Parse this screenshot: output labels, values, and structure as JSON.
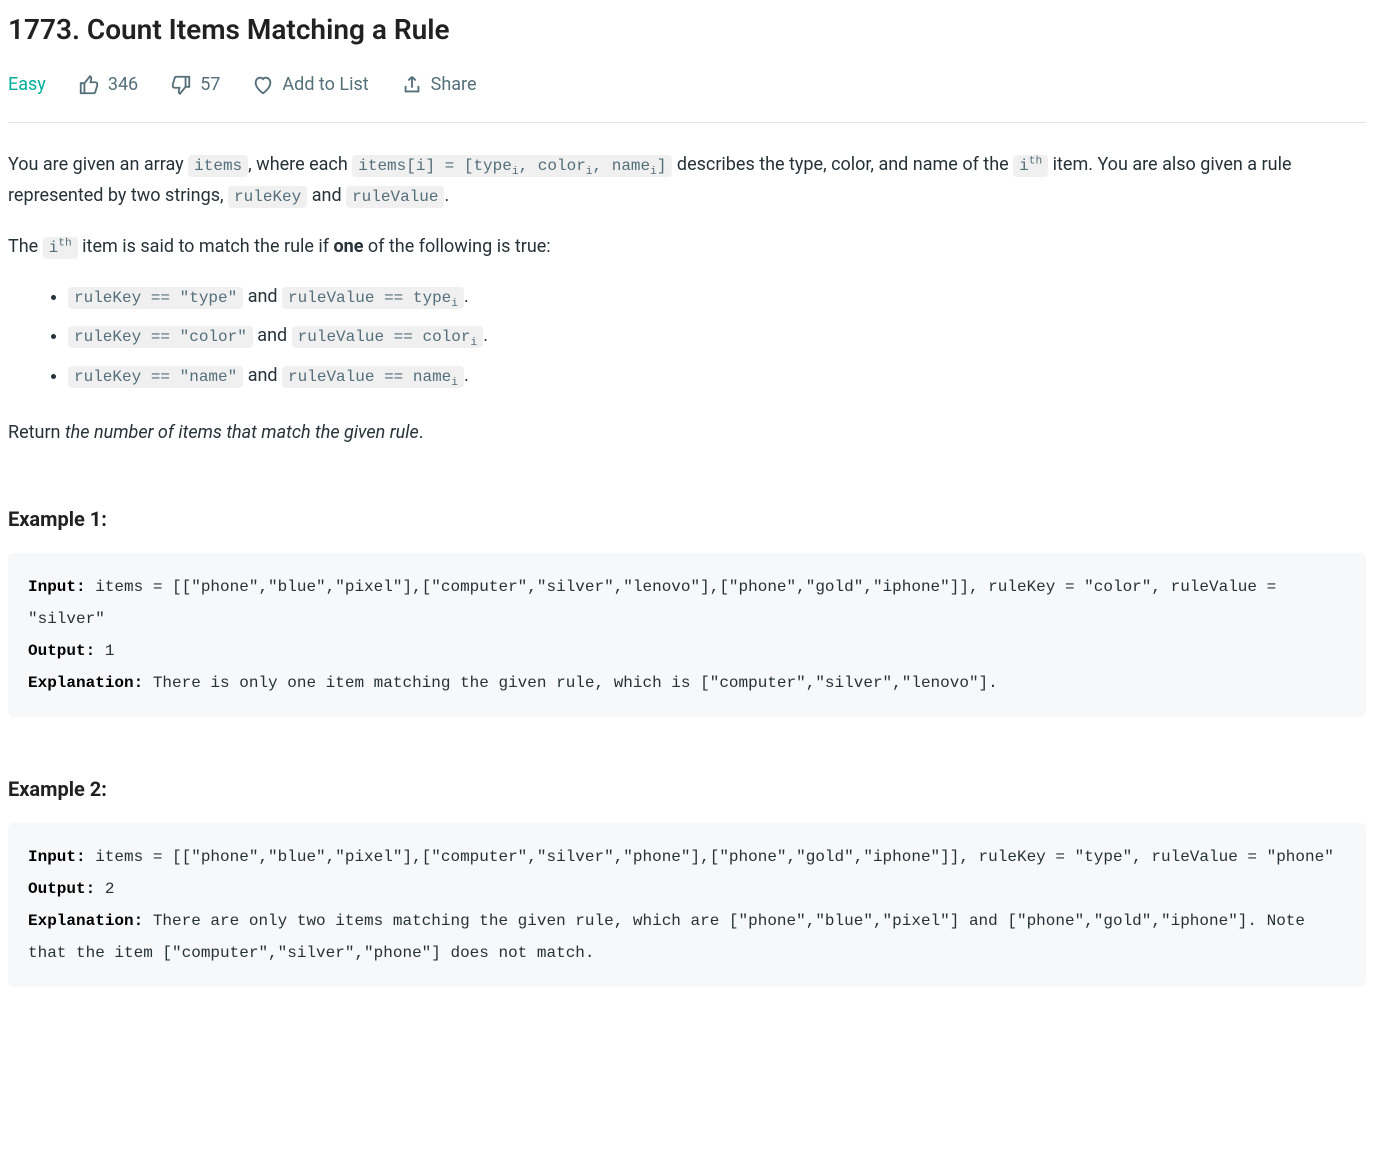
{
  "title": "1773. Count Items Matching a Rule",
  "difficulty": "Easy",
  "likes": "346",
  "dislikes": "57",
  "add_to_list": "Add to List",
  "share": "Share",
  "desc": {
    "p1_prefix": "You are given an array ",
    "p1_items": "items",
    "p1_mid1": ", where each ",
    "p1_itemsi": "items[i] = [type",
    "p1_itemsi_i1": "i",
    "p1_itemsi_mid1": ", color",
    "p1_itemsi_i2": "i",
    "p1_itemsi_mid2": ", name",
    "p1_itemsi_i3": "i",
    "p1_itemsi_end": "]",
    "p1_mid2": " describes the type, color, and name of the ",
    "p1_ith_i": "i",
    "p1_ith_th": "th",
    "p1_mid3": " item. You are also given a rule represented by two strings, ",
    "p1_rulekey": "ruleKey",
    "p1_and": " and ",
    "p1_rulevalue": "ruleValue",
    "p1_end": ".",
    "p2_prefix": "The ",
    "p2_ith_i": "i",
    "p2_ith_th": "th",
    "p2_mid": " item is said to match the rule if ",
    "p2_one": "one",
    "p2_end": " of the following is true:",
    "rules": [
      {
        "key": "ruleKey == \"type\"",
        "and": " and ",
        "val_prefix": "ruleValue == type",
        "val_sub": "i",
        "end": "."
      },
      {
        "key": "ruleKey == \"color\"",
        "and": " and ",
        "val_prefix": "ruleValue == color",
        "val_sub": "i",
        "end": "."
      },
      {
        "key": "ruleKey == \"name\"",
        "and": " and ",
        "val_prefix": "ruleValue == name",
        "val_sub": "i",
        "end": "."
      }
    ],
    "p3_return": "Return ",
    "p3_italic": "the number of items that match the given rule",
    "p3_end": "."
  },
  "examples": [
    {
      "heading": "Example 1:",
      "input_label": "Input:",
      "input_text": " items = [[\"phone\",\"blue\",\"pixel\"],[\"computer\",\"silver\",\"lenovo\"],[\"phone\",\"gold\",\"iphone\"]], ruleKey = \"color\", ruleValue = \"silver\"",
      "output_label": "Output:",
      "output_text": " 1",
      "explanation_label": "Explanation:",
      "explanation_text": " There is only one item matching the given rule, which is [\"computer\",\"silver\",\"lenovo\"]."
    },
    {
      "heading": "Example 2:",
      "input_label": "Input:",
      "input_text": " items = [[\"phone\",\"blue\",\"pixel\"],[\"computer\",\"silver\",\"phone\"],[\"phone\",\"gold\",\"iphone\"]], ruleKey = \"type\", ruleValue = \"phone\"",
      "output_label": "Output:",
      "output_text": " 2",
      "explanation_label": "Explanation:",
      "explanation_text": " There are only two items matching the given rule, which are [\"phone\",\"blue\",\"pixel\"] and [\"phone\",\"gold\",\"iphone\"]. Note that the item [\"computer\",\"silver\",\"phone\"] does not match."
    }
  ]
}
